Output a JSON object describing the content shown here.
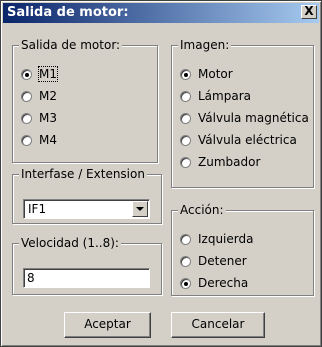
{
  "window": {
    "title": "Salida de motor:",
    "close_label": "X"
  },
  "motor_output": {
    "legend": "Salida de motor:",
    "options": [
      "M1",
      "M2",
      "M3",
      "M4"
    ],
    "selected": "M1"
  },
  "interface": {
    "legend": "Interfase / Extension",
    "value": "IF1"
  },
  "speed": {
    "legend": "Velocidad (1..8):",
    "value": "8"
  },
  "image": {
    "legend": "Imagen:",
    "options": [
      "Motor",
      "Lámpara",
      "Válvula magnética",
      "Válvula eléctrica",
      "Zumbador"
    ],
    "selected": "Motor"
  },
  "action": {
    "legend": "Acción:",
    "options": [
      "Izquierda",
      "Detener",
      "Derecha"
    ],
    "selected": "Derecha"
  },
  "buttons": {
    "ok": "Aceptar",
    "cancel": "Cancelar"
  }
}
